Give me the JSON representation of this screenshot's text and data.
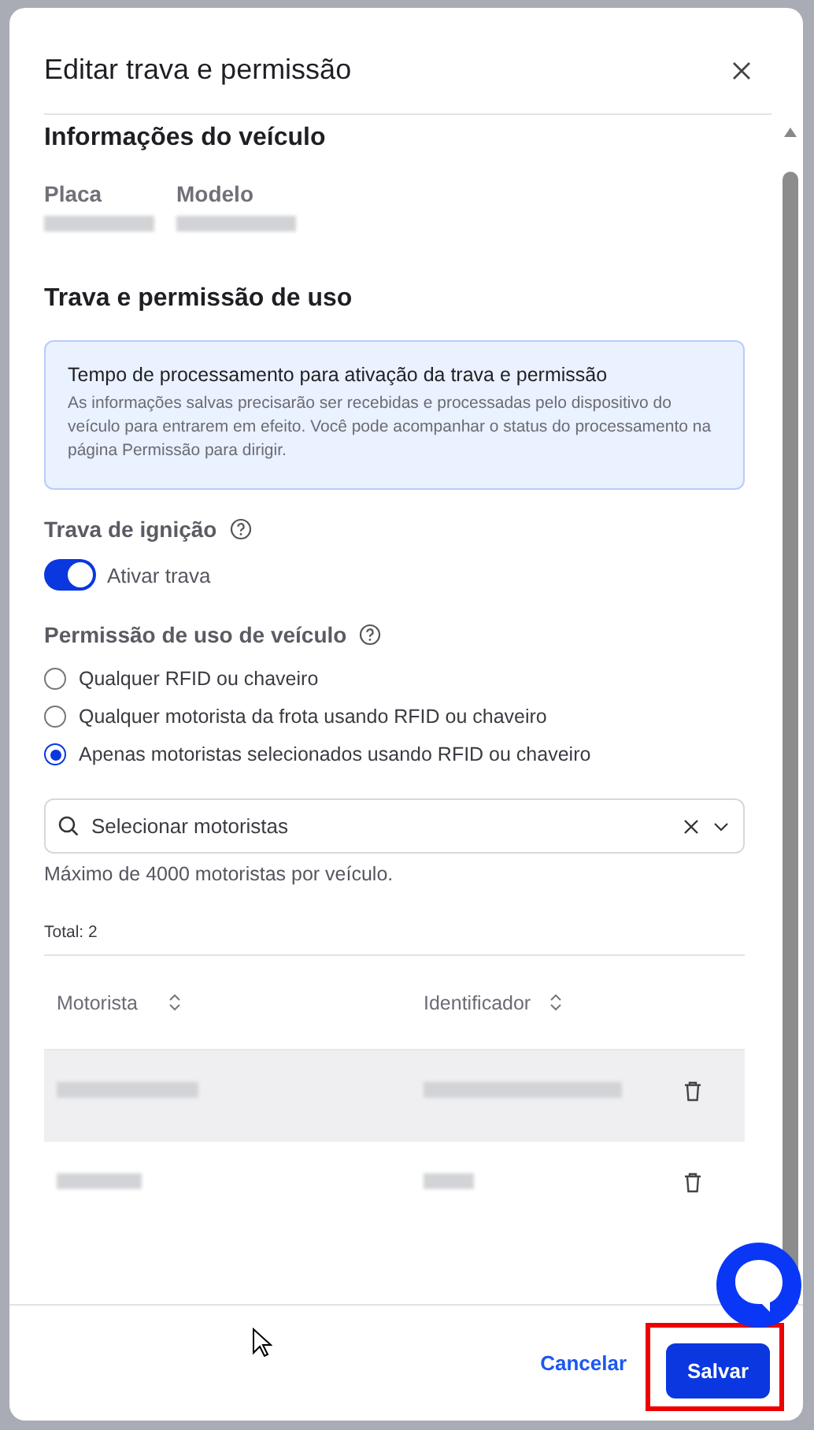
{
  "dialog": {
    "title": "Editar trava e permissão"
  },
  "vehicle": {
    "heading": "Informações do veículo",
    "fields": [
      {
        "label": "Placa"
      },
      {
        "label": "Modelo"
      }
    ]
  },
  "lock_section": {
    "heading": "Trava e permissão de uso",
    "notice": {
      "title": "Tempo de processamento para ativação da trava e permissão",
      "body": "As informações salvas precisarão ser recebidas e processadas pelo dispositivo do veículo para entrarem em efeito. Você pode acompanhar o status do processamento na página Permissão para dirigir."
    },
    "ignition": {
      "label": "Trava de ignição",
      "toggle_label": "Ativar trava",
      "on": true
    },
    "permission": {
      "label": "Permissão de uso de veículo",
      "options": [
        {
          "label": "Qualquer RFID ou chaveiro",
          "selected": false
        },
        {
          "label": "Qualquer motorista da frota usando RFID ou chaveiro",
          "selected": false
        },
        {
          "label": "Apenas motoristas selecionados usando RFID ou chaveiro",
          "selected": true
        }
      ]
    },
    "driver_select": {
      "placeholder": "Selecionar motoristas",
      "hint": "Máximo de 4000 motoristas por veículo."
    },
    "table": {
      "total": "Total: 2",
      "columns": [
        "Motorista",
        "Identificador"
      ],
      "rows": [
        {
          "highlighted": true
        },
        {
          "highlighted": false
        }
      ]
    }
  },
  "footer": {
    "buttons": [
      {
        "label": "Cancelar",
        "kind": "link"
      },
      {
        "label": "Salvar",
        "kind": "primary"
      }
    ]
  }
}
